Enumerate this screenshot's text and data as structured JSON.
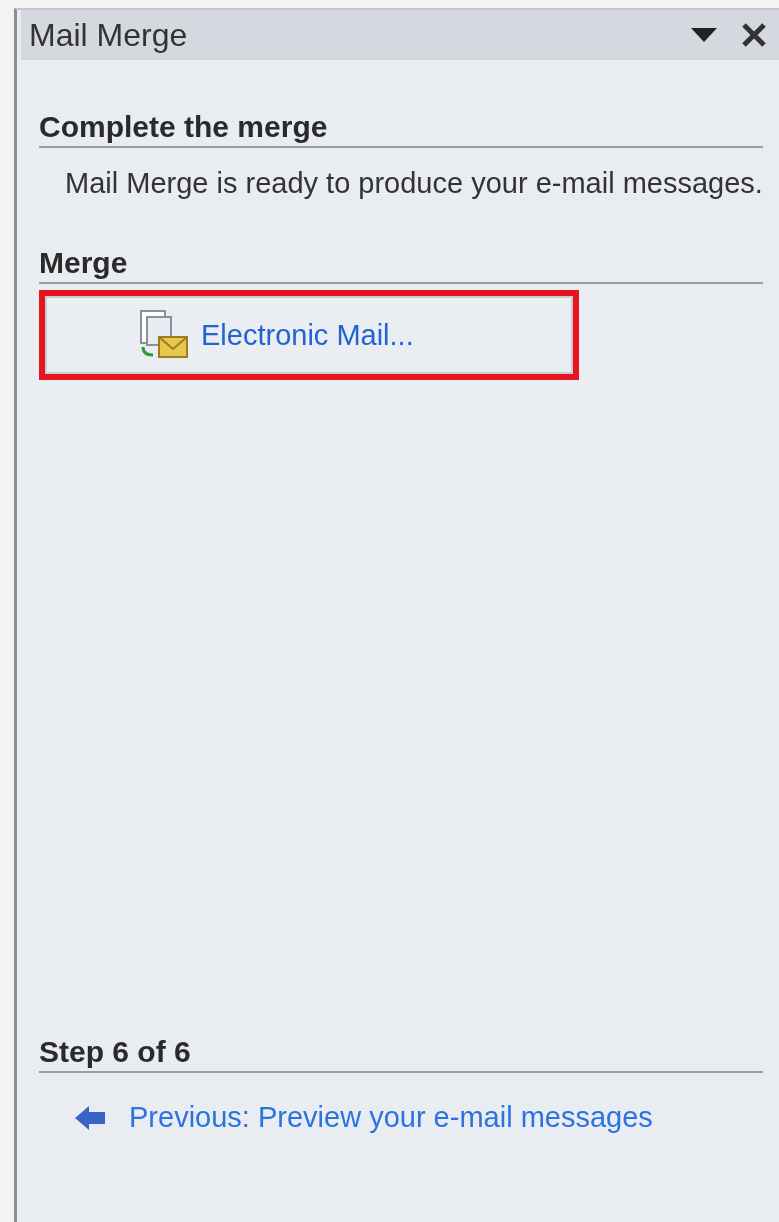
{
  "pane": {
    "title": "Mail Merge"
  },
  "sections": [
    {
      "heading": "Complete the merge",
      "text": "Mail Merge is ready to produce your e-mail messages."
    },
    {
      "heading": "Merge",
      "actions": [
        {
          "label": "Electronic Mail...",
          "highlighted": true
        }
      ]
    }
  ],
  "footer": {
    "heading": "Step 6 of 6",
    "link": "Previous: Preview your e-mail messages"
  }
}
